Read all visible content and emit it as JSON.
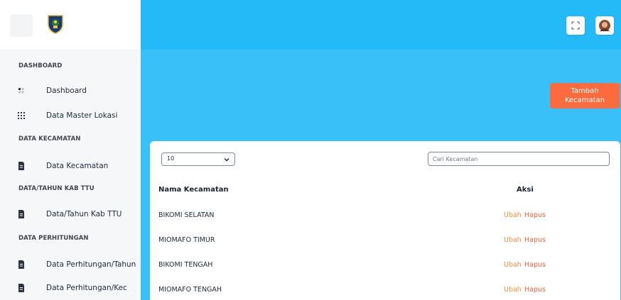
{
  "sidebar": {
    "sections": [
      {
        "heading": "DASHBOARD",
        "items": [
          {
            "label": "Dashboard",
            "icon": "grid-icon"
          },
          {
            "label": "Data Master Lokasi",
            "icon": "dots-grid-icon"
          }
        ]
      },
      {
        "heading": "DATA KECAMATAN",
        "items": [
          {
            "label": "Data Kecamatan",
            "icon": "file-icon"
          }
        ]
      },
      {
        "heading": "DATA/TAHUN KAB TTU",
        "items": [
          {
            "label": "Data/Tahun Kab TTU",
            "icon": "file-icon"
          }
        ]
      },
      {
        "heading": "DATA PERHITUNGAN",
        "items": [
          {
            "label": "Data Perhitungan/Tahun",
            "icon": "file-icon"
          },
          {
            "label": "Data Perhitungan/Kec",
            "icon": "file-icon"
          }
        ]
      }
    ]
  },
  "header": {
    "icons": [
      "fullscreen-icon",
      "user-avatar"
    ]
  },
  "main": {
    "add_button": "Tambah Kecamatan",
    "page_size": "10",
    "search_placeholder": "Cari Kecamatan",
    "table": {
      "columns": [
        "Nama Kecamatan",
        "Aksi"
      ],
      "rows": [
        {
          "name": "BIKOMI SELATAN",
          "edit": "Ubah",
          "delete": "Hapus"
        },
        {
          "name": "MIOMAFO TIMUR",
          "edit": "Ubah",
          "delete": "Hapus"
        },
        {
          "name": "BIKOMI TENGAH",
          "edit": "Ubah",
          "delete": "Hapus"
        },
        {
          "name": "MIOMAFO TENGAH",
          "edit": "Ubah",
          "delete": "Hapus"
        }
      ]
    }
  },
  "colors": {
    "header_blue": "#24b9f7",
    "content_blue": "#39c0f9",
    "add_button": "#fb6b3d",
    "edit_link": "#f28d3f",
    "delete_link": "#f2603d"
  }
}
